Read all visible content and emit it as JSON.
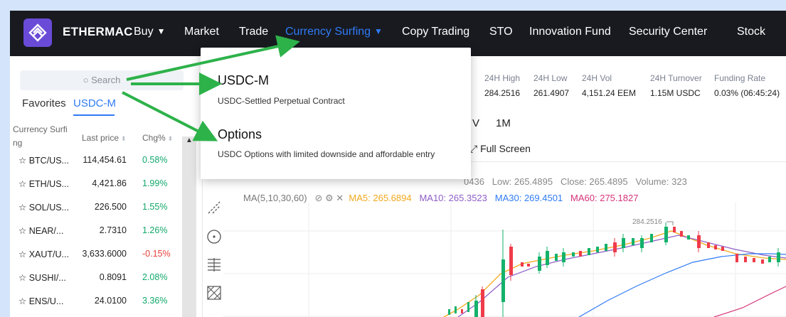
{
  "brand": {
    "name": "ETHERMAC",
    "logo_color": "#6a4bd8"
  },
  "nav": {
    "items": [
      {
        "label": "Buy",
        "has_caret": true
      },
      {
        "label": "Market"
      },
      {
        "label": "Trade"
      },
      {
        "label": "Currency Surfing",
        "has_caret": true,
        "active": true
      },
      {
        "label": "Copy Trading"
      },
      {
        "label": "STO"
      },
      {
        "label": "Innovation Fund"
      },
      {
        "label": "Security Center"
      },
      {
        "label": "Stock"
      }
    ],
    "accent": "#2f7bf5"
  },
  "dropdown": {
    "items": [
      {
        "title": "USDC-M",
        "description": "USDC-Settled Perpetual Contract"
      },
      {
        "title": "Options",
        "description": "USDC Options with limited downside and affordable entry"
      }
    ]
  },
  "sidebar": {
    "search_placeholder": "Search",
    "tabs": [
      {
        "label": "Favorites"
      },
      {
        "label": "USDC-M",
        "active": true
      }
    ],
    "columns": {
      "pair_line1": "Currency Surfi",
      "pair_line2": "ng",
      "last_price": "Last price",
      "change": "Chg%"
    },
    "rows": [
      {
        "symbol": "BTC/US...",
        "price": "114,454.61",
        "change": "0.58%",
        "dir": "up"
      },
      {
        "symbol": "ETH/US...",
        "price": "4,421.86",
        "change": "1.99%",
        "dir": "up"
      },
      {
        "symbol": "SOL/US...",
        "price": "226.500",
        "change": "1.55%",
        "dir": "up"
      },
      {
        "symbol": "NEAR/...",
        "price": "2.7310",
        "change": "1.26%",
        "dir": "up"
      },
      {
        "symbol": "XAUT/U...",
        "price": "3,633.6000",
        "change": "-0.15%",
        "dir": "down"
      },
      {
        "symbol": "SUSHI/...",
        "price": "0.8091",
        "change": "2.08%",
        "dir": "up"
      },
      {
        "symbol": "ENS/U...",
        "price": "24.0100",
        "change": "3.36%",
        "dir": "up"
      }
    ]
  },
  "stats": [
    {
      "label": "24H High",
      "value": "284.2516"
    },
    {
      "label": "24H Low",
      "value": "261.4907"
    },
    {
      "label": "24H Vol",
      "value": "4,151.24 EEM"
    },
    {
      "label": "24H Turnover",
      "value": "1.15M USDC"
    },
    {
      "label": "Funding Rate",
      "value": "0.03% (06:45:24)"
    }
  ],
  "chart_toolbar": {
    "periods": [
      "V",
      "1M"
    ],
    "full_screen": "Full Screen"
  },
  "ohlc": {
    "open_tail": "0436",
    "low_label": "Low:",
    "low": "265.4895",
    "close_label": "Close:",
    "close": "265.4895",
    "volume_label": "Volume:",
    "volume": "323"
  },
  "ma": {
    "label": "MA(5,10,30,60)",
    "ma5_label": "MA5:",
    "ma5": "265.6894",
    "ma10_label": "MA10:",
    "ma10": "265.3523",
    "ma30_label": "MA30:",
    "ma30": "269.4501",
    "ma60_label": "MA60:",
    "ma60": "275.1827",
    "colors": {
      "ma5": "#f2a81d",
      "ma10": "#8e5ec6",
      "ma30": "#2f7bf5",
      "ma60": "#d6337a"
    }
  },
  "chart_annotation": "284.2516",
  "colors": {
    "up": "#12a86b",
    "down": "#e8413a",
    "candle_up": "#13b26b",
    "candle_down": "#ef3b4a",
    "arrow": "#2db24a"
  }
}
